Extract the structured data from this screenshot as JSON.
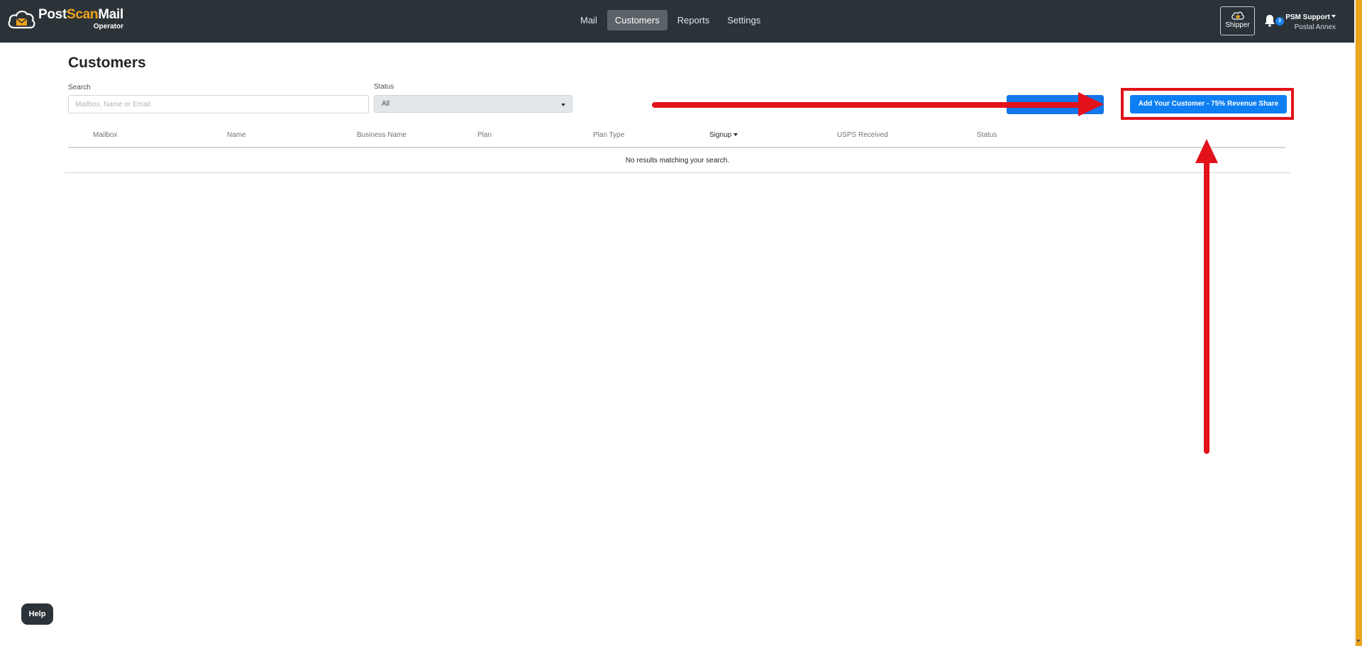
{
  "brand": {
    "name_part1": "Post",
    "name_part2": "Scan",
    "name_part3": "Mail",
    "subtitle": "Operator"
  },
  "nav": {
    "items": [
      {
        "label": "Mail",
        "active": false
      },
      {
        "label": "Customers",
        "active": true
      },
      {
        "label": "Reports",
        "active": false
      },
      {
        "label": "Settings",
        "active": false
      }
    ]
  },
  "header_right": {
    "shipper_label": "Shipper",
    "notification_count": "3",
    "user_name": "PSM Support",
    "user_location": "Postal Annex"
  },
  "page": {
    "title": "Customers",
    "search_label": "Search",
    "search_placeholder": "Mailbox, Name or Email",
    "status_label": "Status",
    "status_value": "All",
    "add_button_label": "Add Your Customer - 75% Revenue Share"
  },
  "table": {
    "columns": [
      "Mailbox",
      "Name",
      "Business Name",
      "Plan",
      "Plan Type",
      "Signup",
      "USPS Received",
      "Status"
    ],
    "sorted_column": "Signup",
    "empty_message": "No results matching your search."
  },
  "help_label": "Help",
  "colors": {
    "navbar": "#2b3338",
    "accent_blue": "#0d7ff2",
    "brand_orange": "#f0a41c",
    "annotation_red": "#e2111a"
  }
}
